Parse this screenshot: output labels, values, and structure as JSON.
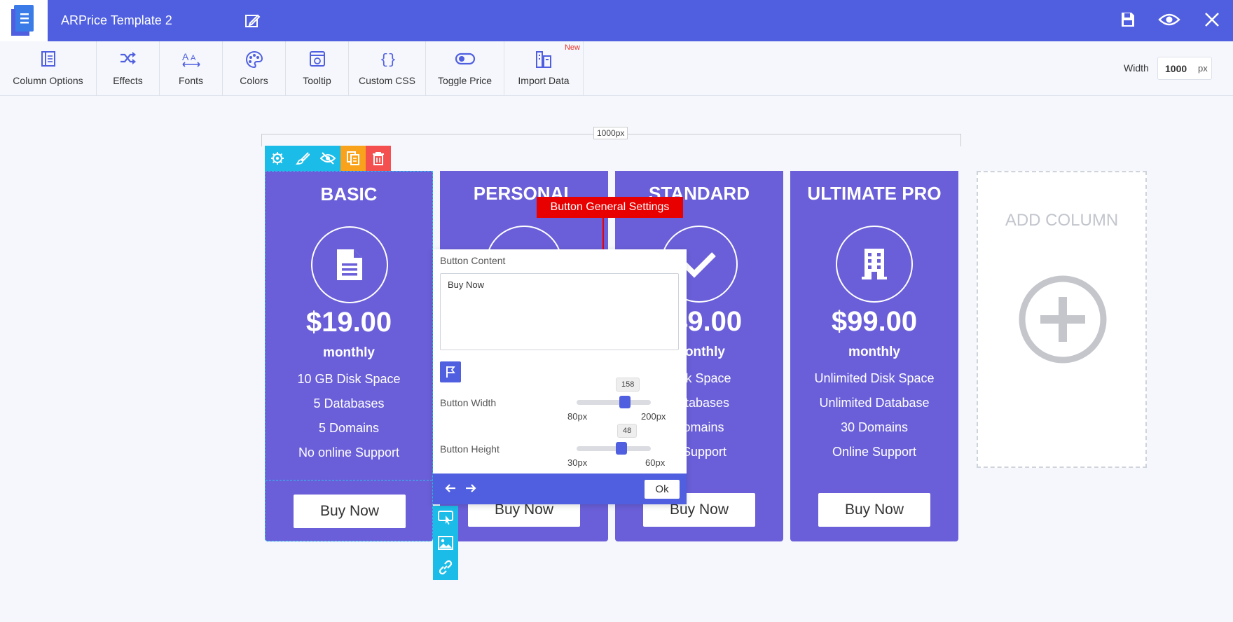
{
  "app": {
    "title": "ARPrice Template 2"
  },
  "toolbar": {
    "items": [
      {
        "label": "Column Options",
        "icon": "column-options-icon"
      },
      {
        "label": "Effects",
        "icon": "shuffle-icon"
      },
      {
        "label": "Fonts",
        "icon": "fonts-icon"
      },
      {
        "label": "Colors",
        "icon": "palette-icon"
      },
      {
        "label": "Tooltip",
        "icon": "tooltip-icon"
      },
      {
        "label": "Custom CSS",
        "icon": "braces-icon"
      },
      {
        "label": "Toggle Price",
        "icon": "toggle-icon"
      },
      {
        "label": "Import Data",
        "icon": "import-data-icon"
      }
    ],
    "new_badge": "New",
    "width_label": "Width",
    "width_value": "1000",
    "width_unit": "px"
  },
  "ruler": {
    "label": "1000px"
  },
  "columns": [
    {
      "title": "BASIC",
      "icon": "document-icon",
      "price": "$19.00",
      "period": "monthly",
      "features": [
        "10 GB Disk Space",
        "5 Databases",
        "5 Domains",
        "No online Support"
      ],
      "button": "Buy Now"
    },
    {
      "title": "PERSONAL",
      "icon": "user-icon",
      "price": "",
      "period": "",
      "features": [],
      "button": "Buy Now"
    },
    {
      "title": "STANDARD",
      "icon": "check-icon",
      "price": "$49.00",
      "period": "monthly",
      "features": [
        "Disk Space",
        "Databases",
        "Domains",
        "e Support"
      ],
      "button": "Buy Now"
    },
    {
      "title": "ULTIMATE PRO",
      "icon": "building-icon",
      "price": "$99.00",
      "period": "monthly",
      "features": [
        "Unlimited Disk Space",
        "Unlimited Database",
        "30 Domains",
        "Online Support"
      ],
      "button": "Buy Now"
    }
  ],
  "add_column": {
    "label": "ADD COLUMN"
  },
  "popup": {
    "tooltip": "Button General Settings",
    "content_label": "Button Content",
    "content_value": "Buy Now",
    "width": {
      "label": "Button Width",
      "value": "158",
      "min": "80px",
      "max": "200px",
      "fraction": 0.65
    },
    "height": {
      "label": "Button Height",
      "value": "48",
      "min": "30px",
      "max": "60px",
      "fraction": 0.6
    },
    "ok": "Ok"
  },
  "colors": {
    "brand": "#4f5fe0",
    "column": "#6a5fd8",
    "accent": "#1bbde8",
    "danger": "#e80000"
  }
}
